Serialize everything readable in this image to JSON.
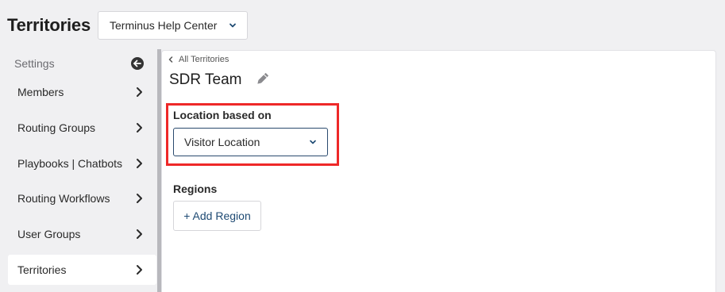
{
  "header": {
    "title": "Territories",
    "workspace_select": "Terminus Help Center"
  },
  "sidebar": {
    "heading": "Settings",
    "items": [
      {
        "label": "Members"
      },
      {
        "label": "Routing Groups"
      },
      {
        "label": "Playbooks | Chatbots"
      },
      {
        "label": "Routing Workflows"
      },
      {
        "label": "User Groups"
      },
      {
        "label": "Territories",
        "active": true
      }
    ]
  },
  "main": {
    "breadcrumb": "All Territories",
    "team_name": "SDR Team",
    "location": {
      "label": "Location based on",
      "value": "Visitor Location"
    },
    "regions": {
      "label": "Regions",
      "add_button": "+ Add Region"
    }
  },
  "colors": {
    "highlight": "#ee2828",
    "link": "#1e4a73"
  },
  "icons": {
    "back": "circle-arrow-left-icon",
    "chevron_down": "chevron-down-icon",
    "chevron_right": "chevron-right-icon",
    "edit": "pencil-icon"
  }
}
